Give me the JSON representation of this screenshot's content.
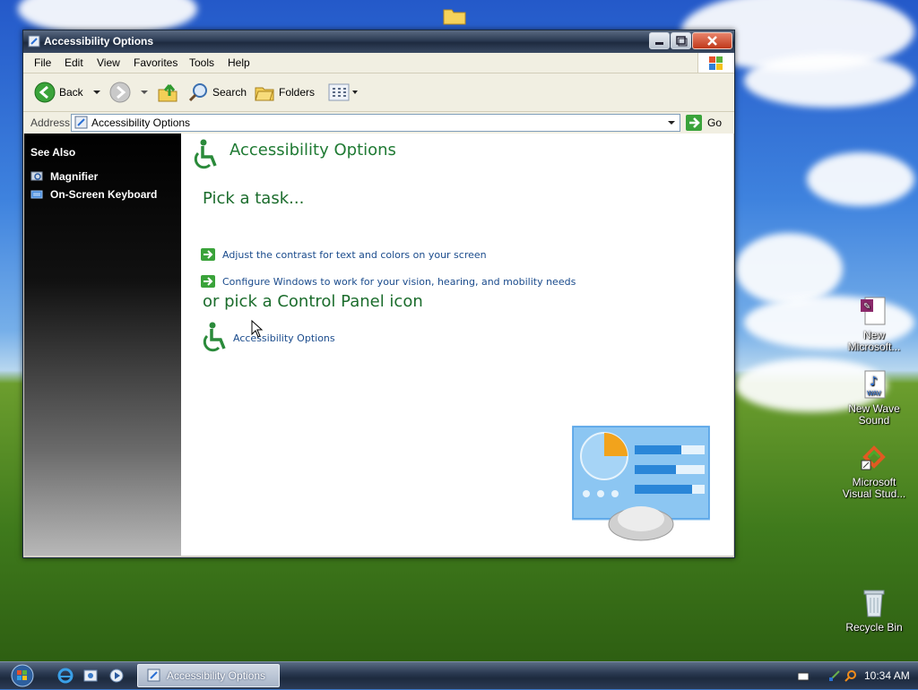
{
  "window": {
    "title": "Accessibility Options"
  },
  "menubar": {
    "items": [
      "File",
      "Edit",
      "View",
      "Favorites",
      "Tools",
      "Help"
    ]
  },
  "toolbar": {
    "back_label": "Back",
    "search_label": "Search",
    "folders_label": "Folders"
  },
  "address": {
    "label": "Address",
    "value": "Accessibility Options",
    "go_label": "Go"
  },
  "sidebar": {
    "header": "See Also",
    "items": [
      {
        "label": "Magnifier",
        "icon": "magnifier-icon"
      },
      {
        "label": "On-Screen Keyboard",
        "icon": "keyboard-icon"
      }
    ]
  },
  "main": {
    "title": "Accessibility Options",
    "task_heading": "Pick a task...",
    "tasks": [
      "Adjust the contrast for text and colors on your screen",
      "Configure Windows to work for your vision, hearing, and mobility needs"
    ],
    "icon_heading": "or pick a Control Panel icon",
    "cp_icon_label": "Accessibility Options"
  },
  "desktop": {
    "icons": [
      {
        "line1": "New",
        "line2": "Microsoft...",
        "icon": "access-db-icon"
      },
      {
        "line1": "New Wave",
        "line2": "Sound",
        "icon": "wav-file-icon"
      },
      {
        "line1": "Microsoft",
        "line2": "Visual Stud...",
        "icon": "visual-studio-icon"
      },
      {
        "line1": "Recycle Bin",
        "line2": "",
        "icon": "recycle-bin-icon"
      }
    ]
  },
  "taskbar": {
    "task_label": "Accessibility Options",
    "clock": "10:34 AM"
  },
  "colors": {
    "link": "#1a4b8c",
    "heading_green": "#1b6c2c",
    "title_bar": "#2b3a52"
  }
}
